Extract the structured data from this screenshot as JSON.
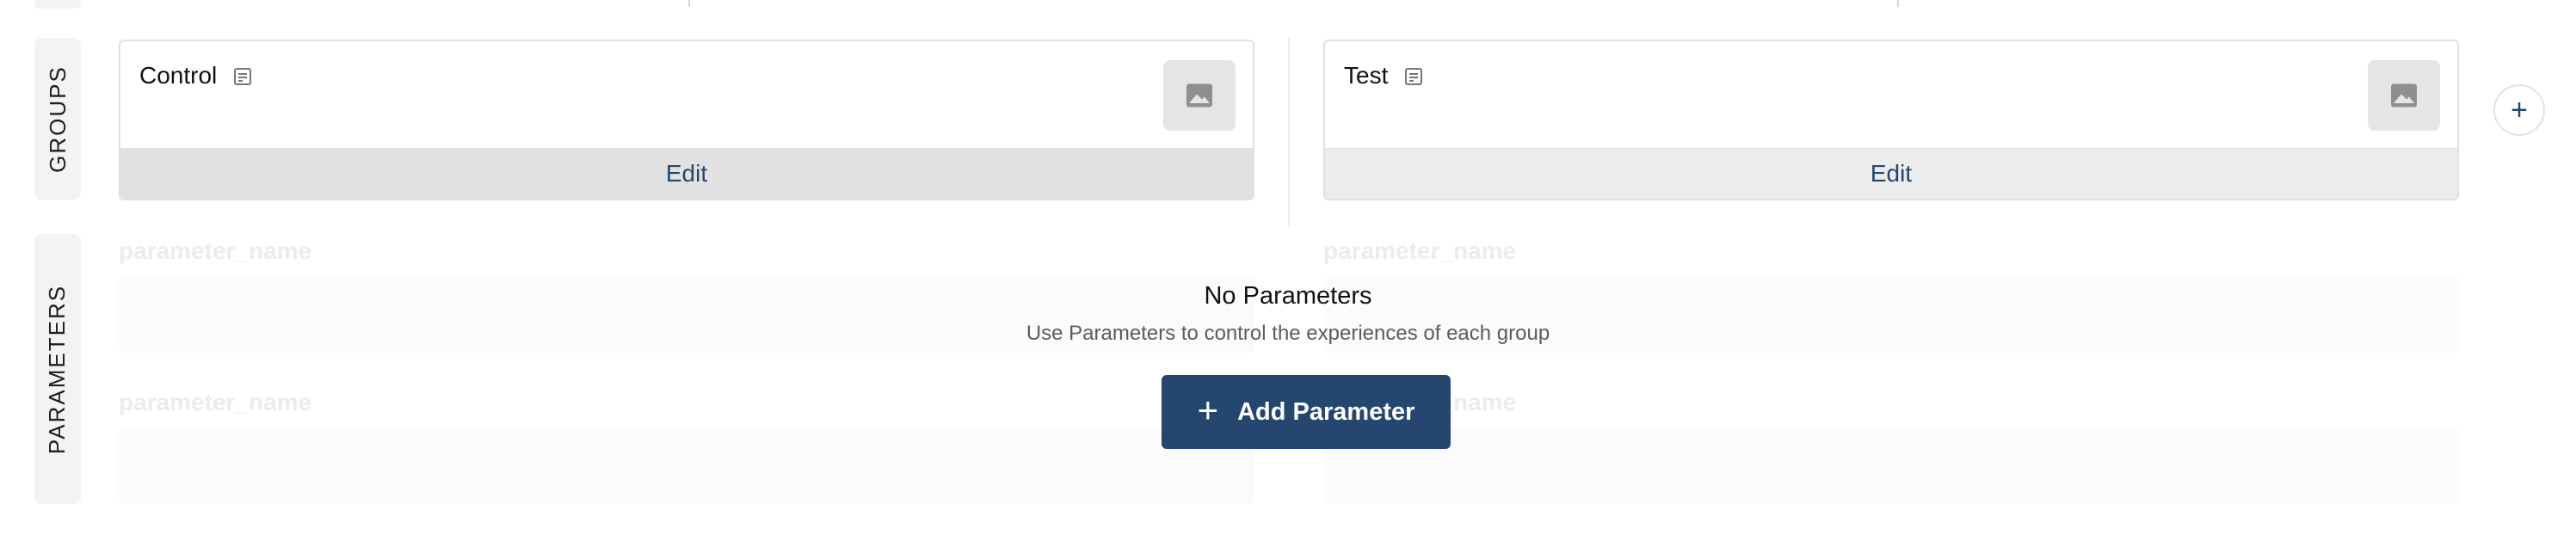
{
  "sections": {
    "groups_label": "GROUPS",
    "parameters_label": "PARAMETERS"
  },
  "groups": [
    {
      "name": "Control",
      "edit_label": "Edit",
      "image_icon": "image-placeholder-icon",
      "note_icon": "note-icon"
    },
    {
      "name": "Test",
      "edit_label": "Edit",
      "image_icon": "image-placeholder-icon",
      "note_icon": "note-icon"
    }
  ],
  "add_group": {
    "icon": "plus-icon",
    "label": "+"
  },
  "parameters": {
    "placeholder_name": "parameter_name",
    "empty_title": "No Parameters",
    "empty_subtitle": "Use Parameters to control the experiences of each group",
    "add_button_label": "Add Parameter",
    "add_button_icon": "+"
  },
  "colors": {
    "accent": "#24466f",
    "tab_bg": "#f3f3f3",
    "card_border": "#e1e1e1"
  }
}
